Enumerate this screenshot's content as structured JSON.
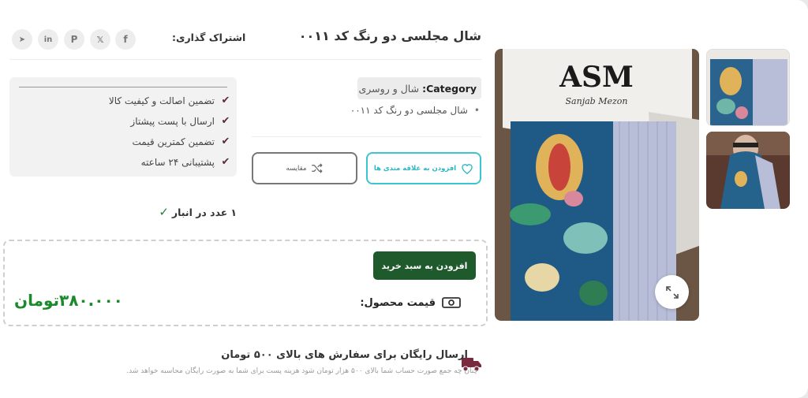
{
  "product": {
    "title": "شال مجلسی دو رنگ کد ۰۰۱۱",
    "category_key": "Category:",
    "category_value": "شال و روسری",
    "bullet": "شال مجلسی دو رنگ کد ۰۰۱۱"
  },
  "share": {
    "label": "اشتراک گذاری:",
    "icons": [
      "facebook-icon",
      "x-twitter-icon",
      "pinterest-icon",
      "linkedin-icon",
      "telegram-icon"
    ],
    "glyphs": [
      "f",
      "𝕏",
      "P",
      "in",
      "➤"
    ]
  },
  "actions": {
    "wishlist_label": "افزودن به علاقه مندی ها",
    "compare_label": "مقایسه",
    "add_to_cart_label": "افزودن به سبد خرید"
  },
  "guarantees": [
    "تضمین اصالت و کیفیت کالا",
    "ارسال با پست پیشتاز",
    "تضمین کمترین قیمت",
    "پشتیبانی ۲۴ ساعته"
  ],
  "stock": {
    "count": "۱",
    "label": "عدد در انبار"
  },
  "price": {
    "label": "قیمت محصول:",
    "value": "۳۸۰.۰۰۰تومان"
  },
  "shipping": {
    "title": "ارسال رایگان برای سفارش های بالای ۵۰۰ تومان",
    "subtitle": "چنان چه جمع صورت حساب شما بالای ۵۰۰ هزار تومان شود هزینه پست برای شما به صورت رایگان محاسبه خواهد شد."
  },
  "gallery": {
    "brand_logo": "ASM",
    "brand_name": "Sanjab Mezon"
  },
  "colors": {
    "accent_green": "#1f5a2c",
    "price_green": "#1b8a2c",
    "wishlist_cyan": "#3cc4d0",
    "check_maroon": "#5c2a3d"
  }
}
